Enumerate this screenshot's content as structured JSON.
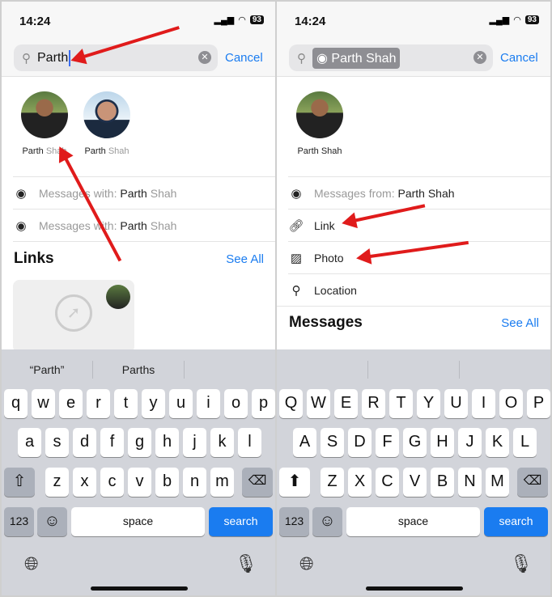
{
  "status": {
    "time": "14:24",
    "battery": "93"
  },
  "left": {
    "search_value": "Parth",
    "cancel": "Cancel",
    "contacts": [
      {
        "first": "Parth",
        "last": "Shah"
      },
      {
        "first": "Parth",
        "last": "Shah"
      }
    ],
    "rows": [
      {
        "prefix": "Messages with:",
        "first": "Parth",
        "last": "Shah",
        "icon": "person-circle-icon"
      },
      {
        "prefix": "Messages with:",
        "first": "Parth",
        "last": "Shah",
        "icon": "person-circle-icon"
      }
    ],
    "section": "Links",
    "see_all": "See All",
    "suggestions": [
      "“Parth”",
      "Parths",
      ""
    ],
    "keys": [
      [
        "q",
        "w",
        "e",
        "r",
        "t",
        "y",
        "u",
        "i",
        "o",
        "p"
      ],
      [
        "a",
        "s",
        "d",
        "f",
        "g",
        "h",
        "j",
        "k",
        "l"
      ],
      [
        "z",
        "x",
        "c",
        "v",
        "b",
        "n",
        "m"
      ]
    ]
  },
  "right": {
    "search_token": "Parth Shah",
    "cancel": "Cancel",
    "contacts": [
      {
        "name": "Parth Shah"
      }
    ],
    "rows": [
      {
        "prefix": "Messages from:",
        "value": "Parth Shah",
        "icon": "person-circle-icon"
      },
      {
        "value": "Link",
        "icon": "link-icon"
      },
      {
        "value": "Photo",
        "icon": "photo-icon"
      },
      {
        "value": "Location",
        "icon": "location-pin-icon"
      }
    ],
    "section": "Messages",
    "see_all": "See All",
    "suggestions": [
      "",
      "",
      ""
    ],
    "keys": [
      [
        "Q",
        "W",
        "E",
        "R",
        "T",
        "Y",
        "U",
        "I",
        "O",
        "P"
      ],
      [
        "A",
        "S",
        "D",
        "F",
        "G",
        "H",
        "J",
        "K",
        "L"
      ],
      [
        "Z",
        "X",
        "C",
        "V",
        "B",
        "N",
        "M"
      ]
    ]
  },
  "keyboard": {
    "numbers": "123",
    "space": "space",
    "search": "search"
  },
  "colors": {
    "accent": "#1a7cf0",
    "annotation_arrow": "#e01b1b"
  }
}
